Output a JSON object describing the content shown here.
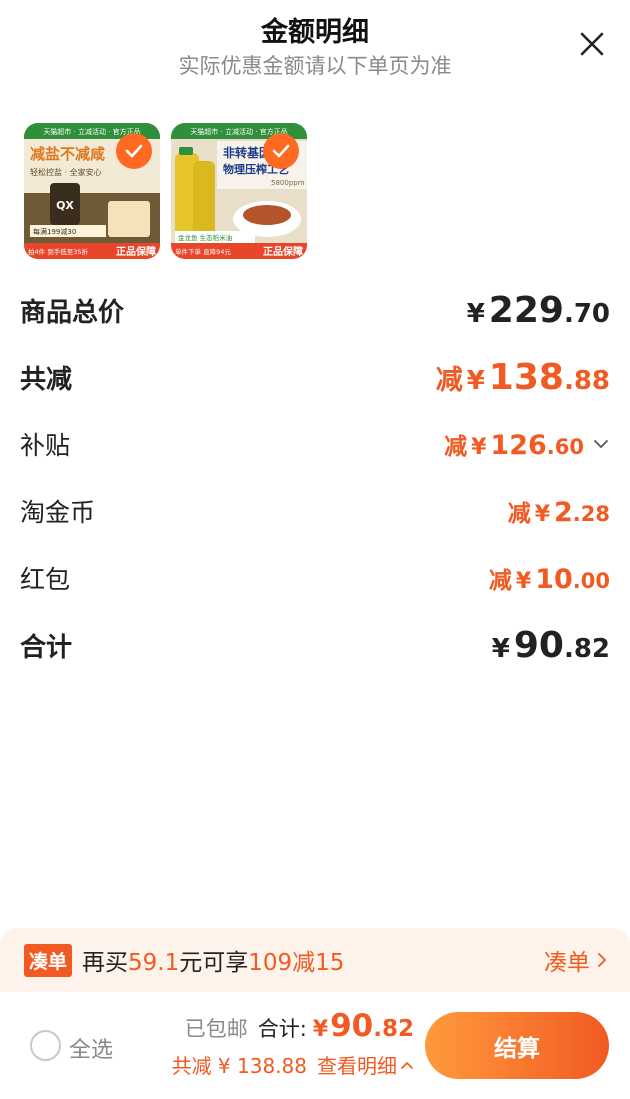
{
  "header": {
    "title": "金额明细",
    "subtitle": "实际优惠金额请以下单页为准"
  },
  "products": [
    {
      "top_tags": "天猫超市 · 立减活动 · 官方正品",
      "headline1": "减盐不减咸",
      "headline2": "轻松控盐 · 全家安心",
      "brand": "QX",
      "promo": "每满199减30",
      "footer_left": "拍4件 到手低至35折",
      "footer_right": "正品保障",
      "selected": true
    },
    {
      "top_tags": "天猫超市 · 立减活动 · 官方正品",
      "headline1": "非转基因",
      "headline2": "物理压榨工艺",
      "spec": "5800ppm",
      "promo": "金龙鱼 生态稻米油",
      "footer_left": "单件下单 直降94元",
      "footer_right": "正品保障",
      "selected": true
    }
  ],
  "summary": {
    "total_price": {
      "label": "商品总价",
      "currency": "¥",
      "int": "229",
      "dec": ".70"
    },
    "total_reduce": {
      "label": "共减",
      "prefix": "减",
      "currency": "¥",
      "int": "138",
      "dec": ".88"
    },
    "subsidy": {
      "label": "补贴",
      "prefix": "减",
      "currency": "¥",
      "int": "126",
      "dec": ".60"
    },
    "taojinbi": {
      "label": "淘金币",
      "prefix": "减",
      "currency": "¥",
      "int": "2",
      "dec": ".28"
    },
    "hongbao": {
      "label": "红包",
      "prefix": "减",
      "currency": "¥",
      "int": "10",
      "dec": ".00"
    },
    "grand_total": {
      "label": "合计",
      "currency": "¥",
      "int": "90",
      "dec": ".82"
    }
  },
  "promo_bar": {
    "tag": "凑单",
    "text_a": "再买",
    "amount": "59.1",
    "text_b": "元可享",
    "deal": "109减15",
    "link": "凑单"
  },
  "footer": {
    "select_all": "全选",
    "shipping": "已包邮",
    "total_label": "合计:",
    "currency": "¥",
    "int": "90",
    "dec": ".82",
    "reduce_text": "共减 ¥ 138.88",
    "view_detail": "查看明细",
    "checkout": "结算"
  },
  "colors": {
    "accent": "#f15a22",
    "promo_bg": "#fdf3eb",
    "checkout_gradient_start": "#ff9a3c",
    "checkout_gradient_end": "#f15a22"
  }
}
